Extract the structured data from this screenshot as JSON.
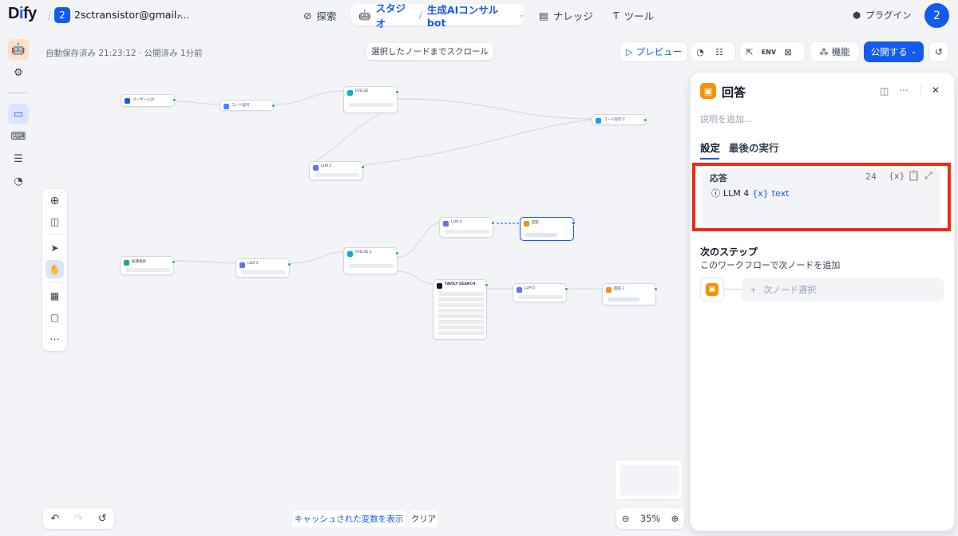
{
  "header": {
    "logo": "Dify",
    "workspace_badge": "2",
    "workspace_name": "2sctransistor@gmail....",
    "nav": {
      "explore": "探索",
      "studio": "スタジオ",
      "app_name": "生成AIコンサルbot",
      "knowledge": "ナレッジ",
      "tools": "ツール"
    },
    "plugins": "プラグイン",
    "avatar": "2"
  },
  "canvas": {
    "status": "自動保存済み 21:23:12 · 公開済み 1分前",
    "scroll_to_selected": "選択したノードまでスクロール",
    "preview": "プレビュー",
    "features": "機能",
    "publish": "公開する",
    "zoom_level": "35%",
    "show_cached_vars": "キャッシュされた変数を表示",
    "clear": "クリア"
  },
  "nodes": [
    {
      "id": "start",
      "title": "ユーザー入力",
      "color": "#155aef"
    },
    {
      "id": "code",
      "title": "コード実行",
      "color": "#2e90fa"
    },
    {
      "id": "ifelse1",
      "title": "IF/ELSE",
      "color": "#06aed4"
    },
    {
      "id": "code2",
      "title": "コード実行 2",
      "color": "#2e90fa"
    },
    {
      "id": "llm2",
      "title": "LLM 2",
      "color": "#6172f3"
    },
    {
      "id": "llm4",
      "title": "LLM 4",
      "color": "#6172f3"
    },
    {
      "id": "answer",
      "title": "回答",
      "color": "#f79009"
    },
    {
      "id": "kr",
      "title": "知識検索",
      "color": "#17b26a"
    },
    {
      "id": "llm3",
      "title": "LLM 3",
      "color": "#6172f3"
    },
    {
      "id": "ifelse2",
      "title": "IF/ELSE 2",
      "color": "#06aed4"
    },
    {
      "id": "tavily",
      "title": "TAVILY SEARCH",
      "color": "#101828"
    },
    {
      "id": "llm5",
      "title": "LLM 5",
      "color": "#6172f3"
    },
    {
      "id": "answer2",
      "title": "回答 2",
      "color": "#f79009"
    }
  ],
  "panel": {
    "title": "回答",
    "description_placeholder": "説明を追加...",
    "tabs": [
      "設定",
      "最後の実行"
    ],
    "response_label": "応答",
    "response_count": "24",
    "response_var_node": "LLM 4",
    "response_var_name": "text",
    "next_step_title": "次のステップ",
    "next_step_desc": "このワークフローで次ノードを追加",
    "next_node_select": "次ノード選択"
  },
  "colors": {
    "accent": "#155aef",
    "answer": "#f79009",
    "highlight": "#ee2c16"
  }
}
